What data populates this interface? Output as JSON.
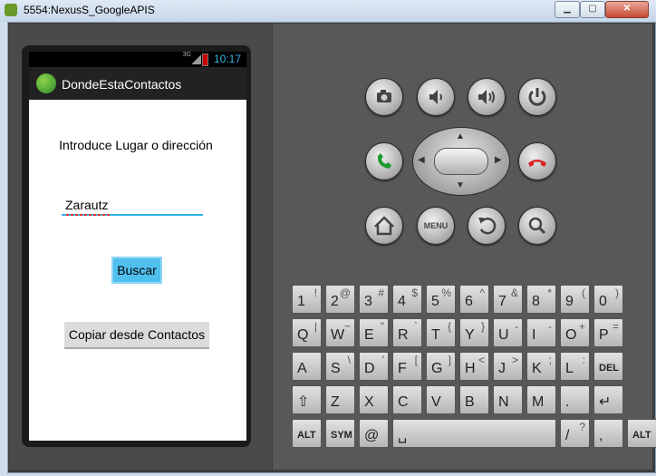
{
  "window": {
    "title": "5554:NexusS_GoogleAPIS",
    "minimize_glyph": "▁",
    "maximize_glyph": "▢",
    "close_glyph": "✕"
  },
  "status_bar": {
    "time": "10:17",
    "network": "3G"
  },
  "app": {
    "title": "DondeEstaContactos",
    "prompt": "Introduce Lugar o dirección",
    "location_input_value": "Zarautz",
    "search_button": "Buscar",
    "copy_button": "Copiar desde Contactos"
  },
  "controls": {
    "menu_label": "MENU"
  },
  "keyboard": {
    "row1": [
      [
        "1",
        "!"
      ],
      [
        "2",
        "@"
      ],
      [
        "3",
        "#"
      ],
      [
        "4",
        "$"
      ],
      [
        "5",
        "%"
      ],
      [
        "6",
        "^"
      ],
      [
        "7",
        "&"
      ],
      [
        "8",
        "*"
      ],
      [
        "9",
        "("
      ],
      [
        "0",
        ")"
      ]
    ],
    "row2": [
      [
        "Q",
        "|"
      ],
      [
        "W",
        "~"
      ],
      [
        "E",
        "\""
      ],
      [
        "R",
        "`"
      ],
      [
        "T",
        "{"
      ],
      [
        "Y",
        "}"
      ],
      [
        "U",
        "-"
      ],
      [
        "I",
        "-"
      ],
      [
        "O",
        "+"
      ],
      [
        "P",
        "="
      ]
    ],
    "row3": [
      [
        "A",
        ""
      ],
      [
        "S",
        "\\"
      ],
      [
        "D",
        "'"
      ],
      [
        "F",
        "["
      ],
      [
        "G",
        "]"
      ],
      [
        "H",
        "<"
      ],
      [
        "J",
        ">"
      ],
      [
        "K",
        ";"
      ],
      [
        "L",
        ":"
      ],
      [
        "DEL",
        ""
      ]
    ],
    "row4": [
      [
        "⇧",
        ""
      ],
      [
        "Z",
        ""
      ],
      [
        "X",
        ""
      ],
      [
        "C",
        ""
      ],
      [
        "V",
        ""
      ],
      [
        "B",
        ""
      ],
      [
        "N",
        ""
      ],
      [
        "M",
        ""
      ],
      [
        ".",
        ""
      ],
      [
        "↵",
        ""
      ]
    ],
    "row5": [
      [
        "ALT",
        ""
      ],
      [
        "SYM",
        ""
      ],
      [
        "@",
        ""
      ],
      [
        "␣",
        ""
      ],
      [
        "/",
        "?"
      ],
      [
        ",",
        ""
      ],
      [
        "ALT",
        ""
      ]
    ]
  }
}
